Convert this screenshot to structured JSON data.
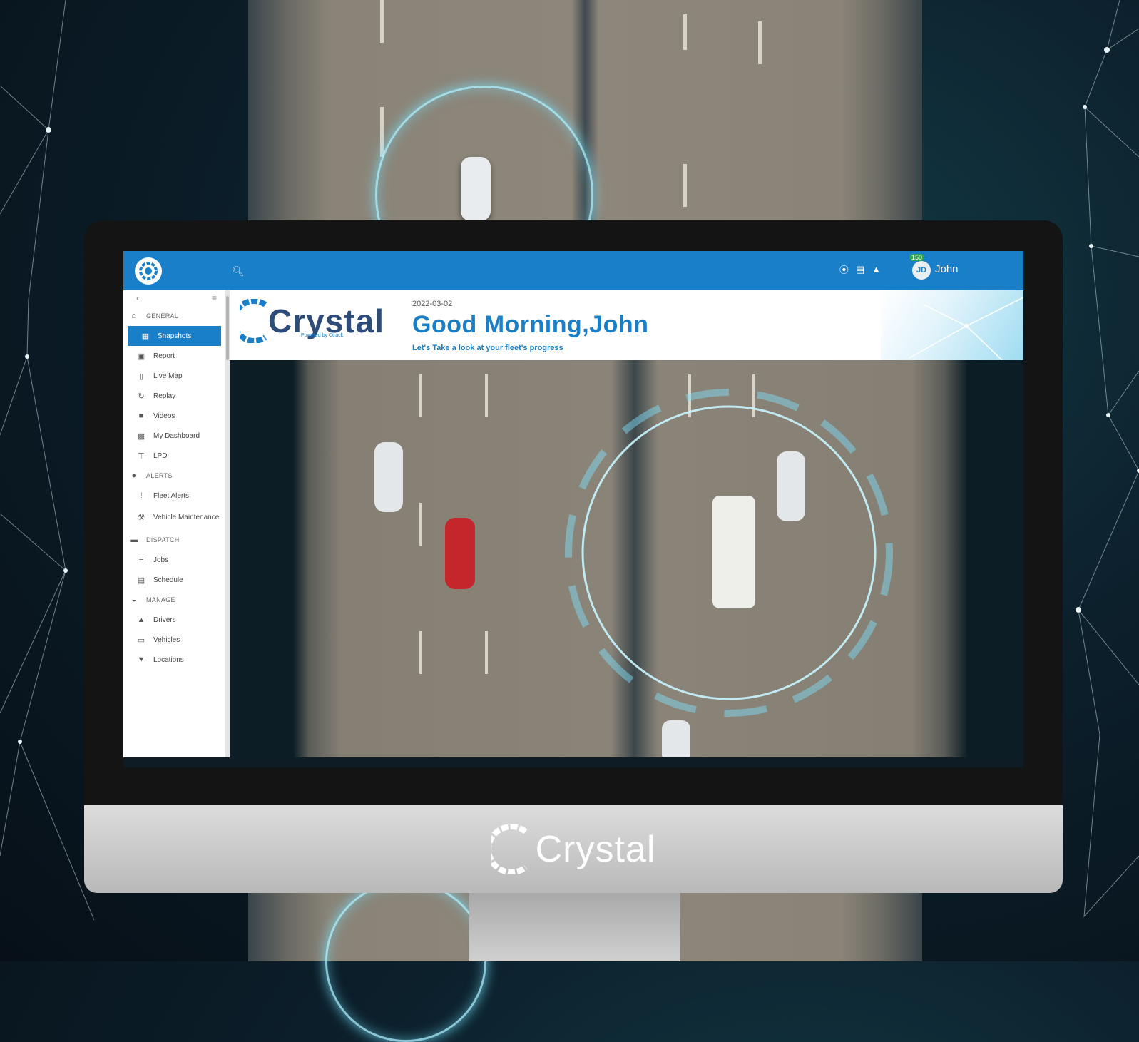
{
  "app": {
    "brand": "Crystal",
    "brand_sub": "Powered by Ctrack",
    "chin_brand": "Crystal"
  },
  "topbar": {
    "search_icon": "search-icon",
    "notification_count": "150",
    "avatar_initials": "JD",
    "username": "John"
  },
  "sidebar": {
    "items": [
      {
        "label": "GENERAL",
        "icon": "home-icon",
        "type": "section"
      },
      {
        "label": "Snapshots",
        "icon": "grid-icon",
        "type": "item",
        "active": true
      },
      {
        "label": "Report",
        "icon": "report-icon",
        "type": "item"
      },
      {
        "label": "Live Map",
        "icon": "map-icon",
        "type": "item"
      },
      {
        "label": "Replay",
        "icon": "replay-icon",
        "type": "item"
      },
      {
        "label": "Videos",
        "icon": "video-icon",
        "type": "item"
      },
      {
        "label": "My Dashboard",
        "icon": "dashboard-icon",
        "type": "item"
      },
      {
        "label": "LPD",
        "icon": "antenna-icon",
        "type": "item"
      },
      {
        "label": "ALERTS",
        "icon": "alert-icon",
        "type": "section"
      },
      {
        "label": "Fleet Alerts",
        "icon": "exclamation-icon",
        "type": "item"
      },
      {
        "label": "Vehicle Maintenance",
        "icon": "wrench-icon",
        "type": "item"
      },
      {
        "label": "DISPATCH",
        "icon": "truck-icon",
        "type": "section"
      },
      {
        "label": "Jobs",
        "icon": "list-icon",
        "type": "item"
      },
      {
        "label": "Schedule",
        "icon": "calendar-icon",
        "type": "item"
      },
      {
        "label": "MANAGE",
        "icon": "manage-icon",
        "type": "section"
      },
      {
        "label": "Drivers",
        "icon": "driver-icon",
        "type": "item"
      },
      {
        "label": "Vehicles",
        "icon": "car-icon",
        "type": "item"
      },
      {
        "label": "Locations",
        "icon": "pin-icon",
        "type": "item"
      }
    ]
  },
  "header": {
    "date": "2022-03-02",
    "greeting": "Good Morning,John",
    "tagline": "Let's Take a look at your fleet's progress"
  },
  "colors": {
    "accent": "#1a7fc9",
    "logo_dark": "#2d4c7a",
    "background": "#0c1f2b"
  }
}
